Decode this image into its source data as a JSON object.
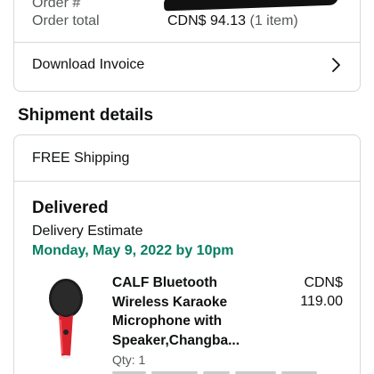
{
  "order_summary": {
    "order_number_label": "Order #",
    "order_total_label": "Order total",
    "order_total_value": "CDN$ 94.13",
    "order_total_items": "(1 item)"
  },
  "invoice": {
    "label": "Download Invoice",
    "icon": "chevron-right-icon"
  },
  "shipment": {
    "section_title": "Shipment details",
    "shipping_method": "FREE Shipping",
    "status": "Delivered",
    "estimate_label": "Delivery Estimate",
    "estimate_date": "Monday, May 9, 2022 by 10pm",
    "item": {
      "title": "CALF Bluetooth Wireless Karaoke Microphone with Speaker,Changba...",
      "price_currency": "CDN$",
      "price_amount": "119.00",
      "quantity": "Qty: 1"
    }
  },
  "colors": {
    "delivery_date": "#067d62",
    "border": "#d5d9d9",
    "muted_text": "#565959"
  }
}
